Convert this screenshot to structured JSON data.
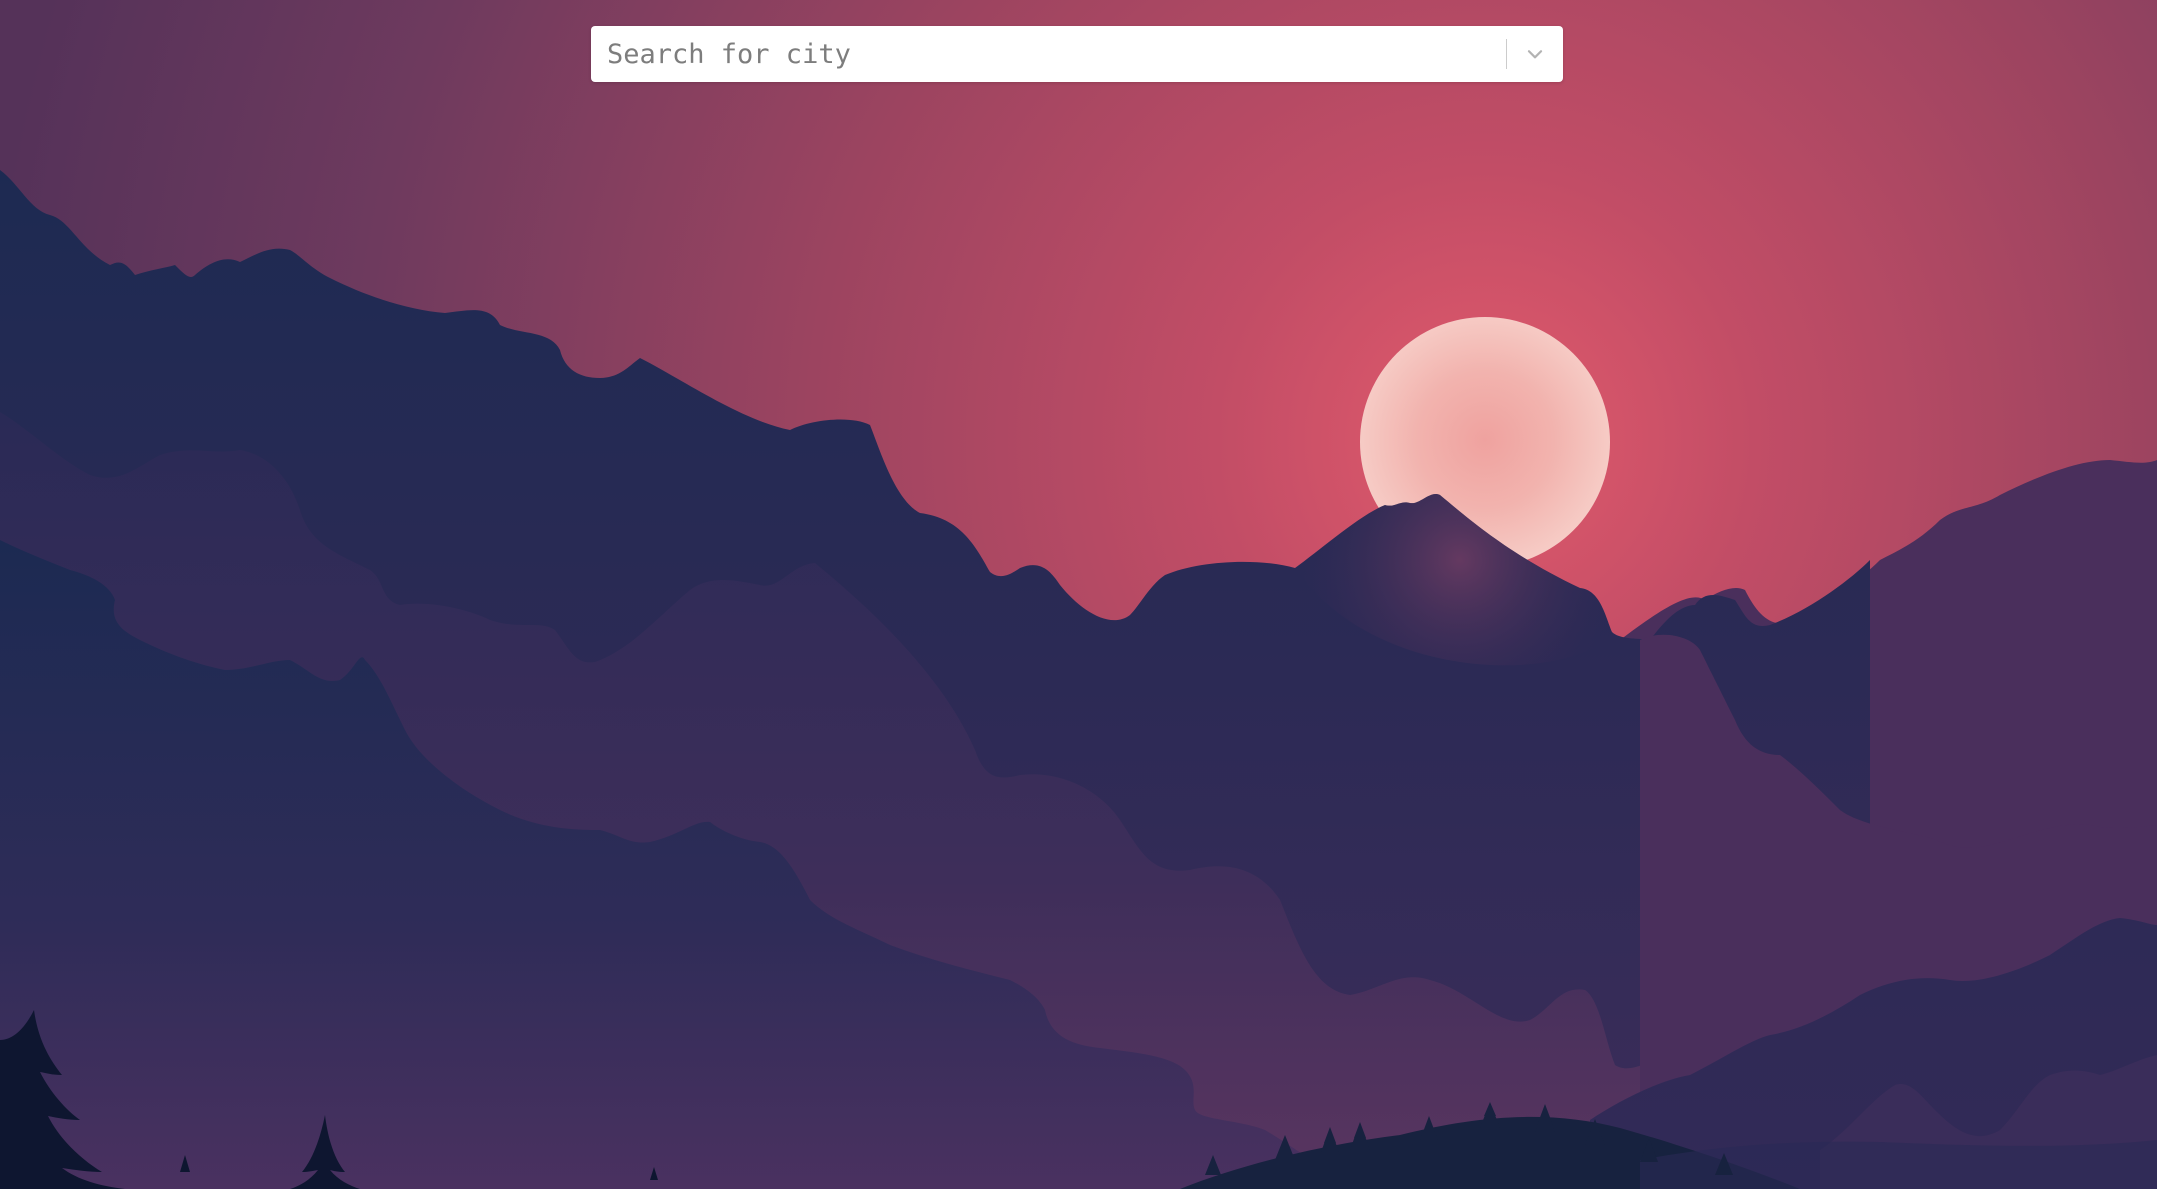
{
  "search": {
    "placeholder": "Search for city",
    "value": ""
  },
  "icons": {
    "dropdown": "chevron-down-icon"
  },
  "colors": {
    "sky_top": "#5e3a5e",
    "sky_mid": "#b04a68",
    "sun_glow": "#e05a70",
    "sun": "#f5c0b8",
    "mountain_far": "#2a2a55",
    "mountain_mid": "#332a58",
    "mountain_near": "#1c2a50",
    "trees": "#0e1733"
  }
}
